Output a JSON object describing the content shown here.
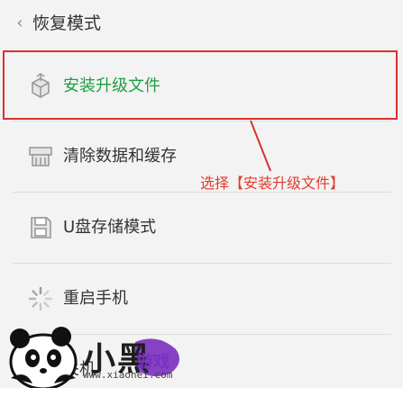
{
  "header": {
    "back_glyph": "‹",
    "title": "恢复模式"
  },
  "menu": {
    "items": [
      {
        "label": "安装升级文件",
        "icon": "package-box-icon",
        "selected": true
      },
      {
        "label": "清除数据和缓存",
        "icon": "clear-data-icon",
        "selected": false
      },
      {
        "label": "U盘存储模式",
        "icon": "usb-storage-icon",
        "selected": false
      },
      {
        "label": "重启手机",
        "icon": "restart-spinner-icon",
        "selected": false
      },
      {
        "label": "关机",
        "icon": "power-icon",
        "selected": false
      }
    ]
  },
  "annotation": {
    "text": "选择【安装升级文件】",
    "color": "#e33b2f"
  },
  "colors": {
    "selected_text": "#1f9e42",
    "highlight_border": "#d9312f",
    "text": "#333333",
    "background": "#f3f3f3"
  },
  "watermark": {
    "brand": "小黑",
    "brand_suffix": "游戏",
    "url": "www.xiaohei.com"
  }
}
